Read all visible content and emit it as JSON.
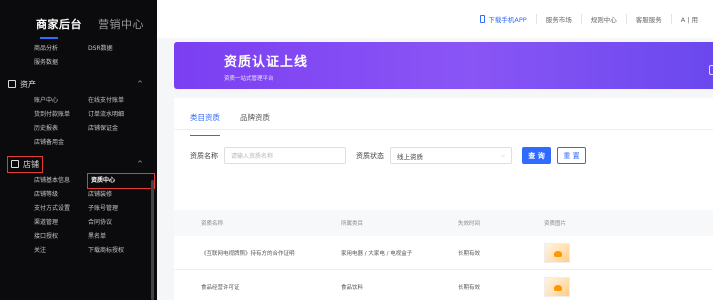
{
  "sidebar": {
    "tab_active": "商家后台",
    "tab_other": "营销中心",
    "top_links": [
      "商品分析",
      "DSR数据",
      "服务数据",
      ""
    ],
    "sections": [
      {
        "label": "资产",
        "caret": "^",
        "links": [
          "账户中心",
          "在线支付账单",
          "货到付款账单",
          "订单流水明细",
          "历史报表",
          "店铺保证金",
          "店铺备用金",
          ""
        ]
      },
      {
        "label": "店铺",
        "caret": "^",
        "links": [
          "店铺基本信息",
          "资质中心",
          "店铺等级",
          "店铺装修",
          "支付方式设置",
          "子账号管理",
          "渠道管理",
          "合同协议",
          "接口授权",
          "黑名单",
          "关注",
          "下载商标授权"
        ]
      }
    ]
  },
  "topbar": {
    "items": [
      "下载手机APP",
      "服务市场",
      "规则中心",
      "客服服务",
      "A | 用"
    ]
  },
  "banner": {
    "title": "资质认证上线",
    "subtitle": "资质一站式管理平台"
  },
  "tabs": [
    "类目资质",
    "品牌资质"
  ],
  "filters": {
    "name_label": "资质名称",
    "name_placeholder": "请输入资质名称",
    "status_label": "资质状态",
    "status_value": "线上资质",
    "search_label": "查 询",
    "reset_label": "重 置"
  },
  "table": {
    "headers": [
      "资质名称",
      "所属类目",
      "失效时间",
      "资质图片"
    ],
    "rows": [
      [
        "《互联网电视牌照》持有方的合作证明",
        "家用电器 / 大家电 / 电视盒子",
        "长期有效",
        ""
      ],
      [
        "食品经营许可证",
        "食品饮料",
        "长期有效",
        ""
      ]
    ]
  }
}
